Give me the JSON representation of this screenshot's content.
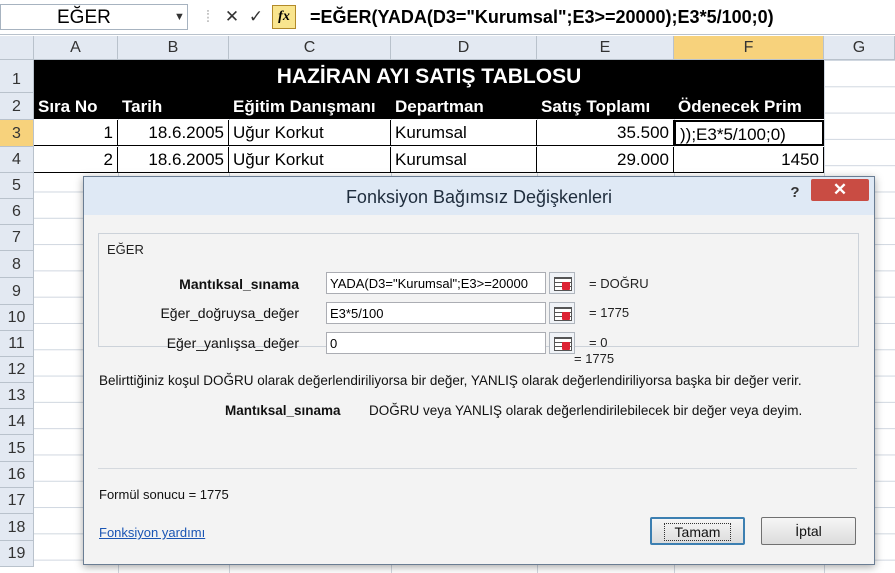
{
  "formula_bar": {
    "name_box": "EĞER",
    "cancel_icon": "close-icon",
    "enter_icon": "checkmark-icon",
    "fx_label": "fx",
    "formula": "=EĞER(YADA(D3=\"Kurumsal\";E3>=20000);E3*5/100;0)"
  },
  "columns": [
    "A",
    "B",
    "C",
    "D",
    "E",
    "F",
    "G"
  ],
  "selected_column": "F",
  "rows": [
    "1",
    "2",
    "3",
    "4",
    "5",
    "6",
    "7",
    "8",
    "9",
    "10",
    "11",
    "12",
    "13",
    "14",
    "15",
    "16",
    "17",
    "18",
    "19"
  ],
  "selected_row": "3",
  "sheet": {
    "title": "HAZİRAN AYI SATIŞ TABLOSU",
    "headers": [
      "Sıra No",
      "Tarih",
      "Eğitim Danışmanı",
      "Departman",
      "Satış Toplamı",
      "Ödenecek Prim"
    ],
    "row3": [
      "1",
      "18.6.2005",
      "Uğur Korkut",
      "Kurumsal",
      "35.500",
      "));E3*5/100;0)"
    ],
    "row4": [
      "2",
      "18.6.2005",
      "Uğur Korkut",
      "Kurumsal",
      "29.000",
      "1450"
    ]
  },
  "dialog": {
    "title": "Fonksiyon Bağımsız Değişkenleri",
    "help": "?",
    "close": "✕",
    "group_label": "EĞER",
    "args": [
      {
        "label": "Mantıksal_sınama",
        "value": "YADA(D3=\"Kurumsal\";E3>=20000",
        "result": "=  DOĞRU"
      },
      {
        "label": "Eğer_doğruysa_değer",
        "value": "E3*5/100",
        "result": "=  1775"
      },
      {
        "label": "Eğer_yanlışsa_değer",
        "value": "0",
        "result": "=  0"
      }
    ],
    "overall_result": "=  1775",
    "description": "Belirttiğiniz koşul DOĞRU olarak değerlendiriliyorsa bir değer, YANLIŞ olarak değerlendiriliyorsa başka bir değer verir.",
    "arg_desc_label": "Mantıksal_sınama",
    "arg_desc_text": "DOĞRU veya YANLIŞ olarak değerlendirilebilecek bir değer veya deyim.",
    "formula_result": "Formül sonucu =   1775",
    "help_link": "Fonksiyon yardımı",
    "ok": "Tamam",
    "cancel": "İptal"
  }
}
